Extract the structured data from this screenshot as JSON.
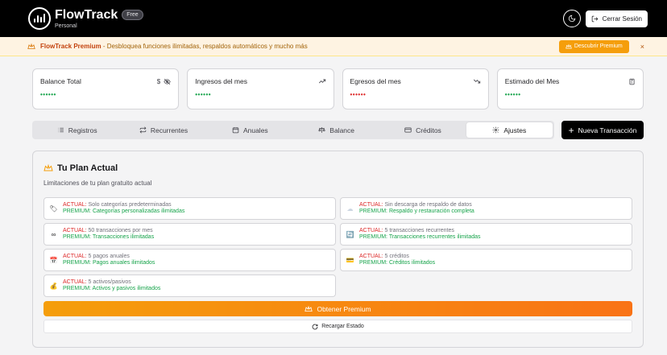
{
  "header": {
    "brand": "FlowTrack",
    "badge": "Free",
    "subtitle": "Personal",
    "logout_label": "Cerrar Sesión"
  },
  "banner": {
    "strong": "FlowTrack Premium",
    "text": " - Desbloquea funciones ilimitadas, respaldos automáticos y mucho más",
    "cta": "Descubrir Premium",
    "close": "×"
  },
  "stats": [
    {
      "label": "Balance Total",
      "value": "••••••",
      "tone": "green"
    },
    {
      "label": "Ingresos del mes",
      "value": "••••••",
      "tone": "green"
    },
    {
      "label": "Egresos del mes",
      "value": "••••••",
      "tone": "red"
    },
    {
      "label": "Estimado del Mes",
      "value": "••••••",
      "tone": "green"
    }
  ],
  "tabs": [
    {
      "label": "Registros",
      "icon": "list-icon"
    },
    {
      "label": "Recurrentes",
      "icon": "repeat-icon"
    },
    {
      "label": "Anuales",
      "icon": "calendar-icon"
    },
    {
      "label": "Balance",
      "icon": "scale-icon"
    },
    {
      "label": "Créditos",
      "icon": "credit-card-icon"
    },
    {
      "label": "Ajustes",
      "icon": "gear-icon",
      "active": true
    }
  ],
  "new_transaction": "Nueva Transacción",
  "plan": {
    "title": "Tu Plan Actual",
    "subtitle": "Limitaciones de tu plan gratuito actual",
    "current_prefix": "ACTUAL:",
    "premium_prefix": "PREMIUM:",
    "items": [
      {
        "icon": "🏷",
        "current": " Solo categorías predeterminadas",
        "premium": " Categorías personalizadas ilimitadas"
      },
      {
        "icon": "☁",
        "current": " Sin descarga de respaldo de datos",
        "premium": " Respaldo y restauración completa"
      },
      {
        "icon": "∞",
        "current": " 50 transacciones por mes",
        "premium": " Transacciones ilimitadas"
      },
      {
        "icon": "🔄",
        "current": " 5 transacciones recurrentes",
        "premium": " Transacciones recurrentes ilimitadas"
      },
      {
        "icon": "📅",
        "current": " 5 pagos anuales",
        "premium": " Pagos anuales ilimitados"
      },
      {
        "icon": "💳",
        "current": " 5 créditos",
        "premium": " Créditos ilimitados"
      },
      {
        "icon": "💰",
        "current": " 5 activos/pasivos",
        "premium": " Activos y pasivos ilimitados"
      }
    ],
    "cta": "Obtener Premium",
    "reload": "Recargar Estado"
  }
}
